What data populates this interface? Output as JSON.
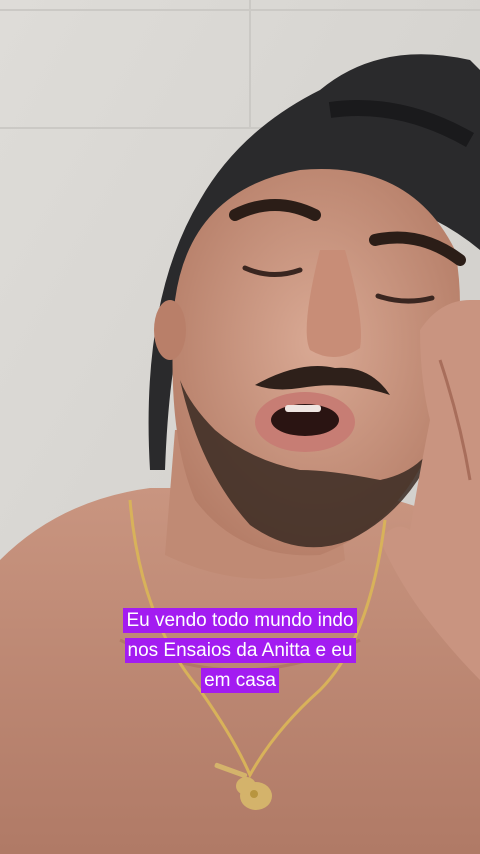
{
  "video": {
    "caption_lines": [
      "Eu vendo todo mundo indo",
      "nos Ensaios da Anitta e eu",
      "em casa"
    ],
    "caption_background": "#a31cf1",
    "caption_text_color": "#ffffff"
  }
}
